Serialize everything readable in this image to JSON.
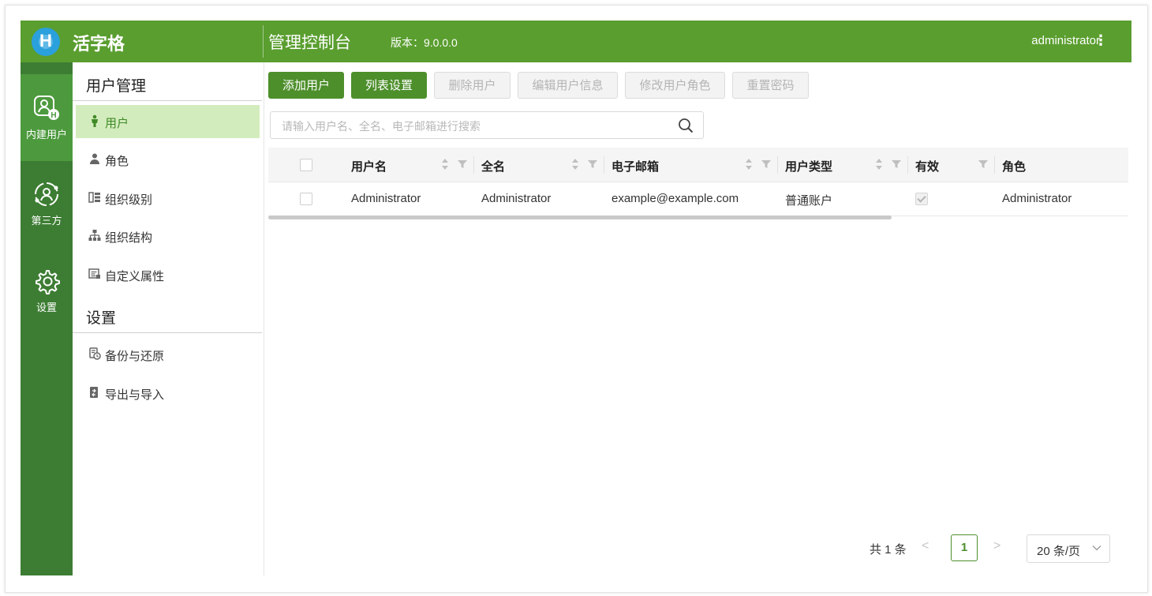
{
  "header": {
    "brand": "活字格",
    "console_title": "管理控制台",
    "version_label": "版本：9.0.0.0",
    "username": "administrator",
    "kebab": "⋮"
  },
  "rail": [
    {
      "label": "内建用户",
      "icon": "built-in-user-icon",
      "active": true
    },
    {
      "label": "第三方",
      "icon": "third-party-icon",
      "active": false
    },
    {
      "label": "设置",
      "icon": "gear-icon",
      "active": false
    }
  ],
  "menu": {
    "section_users": "用户管理",
    "items_users": [
      {
        "label": "用户",
        "icon": "user-icon",
        "active": true
      },
      {
        "label": "角色",
        "icon": "role-icon",
        "active": false
      },
      {
        "label": "组织级别",
        "icon": "org-level-icon",
        "active": false
      },
      {
        "label": "组织结构",
        "icon": "org-structure-icon",
        "active": false
      },
      {
        "label": "自定义属性",
        "icon": "custom-attribute-icon",
        "active": false
      }
    ],
    "section_settings": "设置",
    "items_settings": [
      {
        "label": "备份与还原",
        "icon": "backup-restore-icon"
      },
      {
        "label": "导出与导入",
        "icon": "export-import-icon"
      }
    ]
  },
  "toolbar": {
    "add_user": "添加用户",
    "list_settings": "列表设置",
    "delete_user": "删除用户",
    "edit_user_info": "编辑用户信息",
    "modify_user_role": "修改用户角色",
    "reset_password": "重置密码"
  },
  "search": {
    "placeholder": "请输入用户名、全名、电子邮箱进行搜索",
    "value": ""
  },
  "table": {
    "columns": [
      "用户名",
      "全名",
      "电子邮箱",
      "用户类型",
      "有效",
      "角色"
    ],
    "rows": [
      {
        "username": "Administrator",
        "fullname": "Administrator",
        "email": "example@example.com",
        "user_type": "普通账户",
        "valid": true,
        "role": "Administrator"
      }
    ]
  },
  "pagination": {
    "total_text": "共 1 条",
    "prev": "<",
    "current_page": "1",
    "next": ">",
    "page_size": "20 条/页"
  },
  "colors": {
    "header_green": "#5a9e2f",
    "rail_green": "#3d7d33",
    "primary_button": "#4d8f2b",
    "active_menu_bg": "#d3ecbd"
  }
}
